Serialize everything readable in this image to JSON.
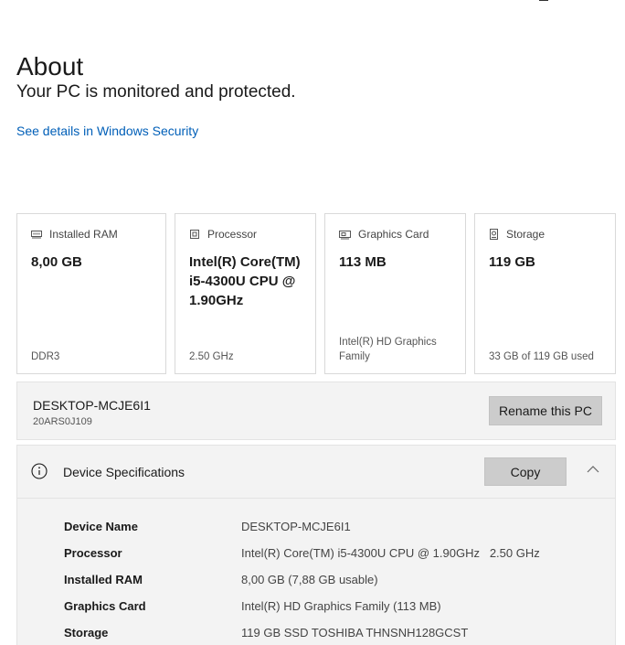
{
  "page": {
    "title": "About",
    "status": "Your PC is monitored and protected.",
    "security_link": "See details in Windows Security"
  },
  "cards": [
    {
      "label": "Installed RAM",
      "value": "8,00 GB",
      "footer": "DDR3",
      "icon": "ram-icon"
    },
    {
      "label": "Processor",
      "value": "Intel(R) Core(TM) i5-4300U CPU @ 1.90GHz",
      "footer": "2.50 GHz",
      "icon": "processor-icon"
    },
    {
      "label": "Graphics Card",
      "value": "113 MB",
      "footer": "Intel(R) HD Graphics Family",
      "icon": "graphics-card-icon"
    },
    {
      "label": "Storage",
      "value": "119 GB",
      "footer": "33 GB of 119 GB used",
      "icon": "storage-icon"
    }
  ],
  "pc": {
    "name": "DESKTOP-MCJE6I1",
    "model": "20ARS0J109",
    "rename_label": "Rename this PC"
  },
  "specs": {
    "title": "Device Specifications",
    "copy_label": "Copy",
    "rows": [
      {
        "label": "Device Name",
        "value": "DESKTOP-MCJE6I1"
      },
      {
        "label": "Processor",
        "value": "Intel(R) Core(TM) i5-4300U CPU @ 1.90GHz   2.50 GHz"
      },
      {
        "label": "Installed RAM",
        "value": "8,00 GB (7,88 GB usable)"
      },
      {
        "label": "Graphics Card",
        "value": "Intel(R) HD Graphics Family (113 MB)"
      },
      {
        "label": "Storage",
        "value": "119 GB SSD TOSHIBA THNSNH128GCST"
      }
    ]
  },
  "colors": {
    "link": "#005fb8",
    "panel_bg": "#f3f3f3",
    "button_bg": "#cccccc"
  }
}
